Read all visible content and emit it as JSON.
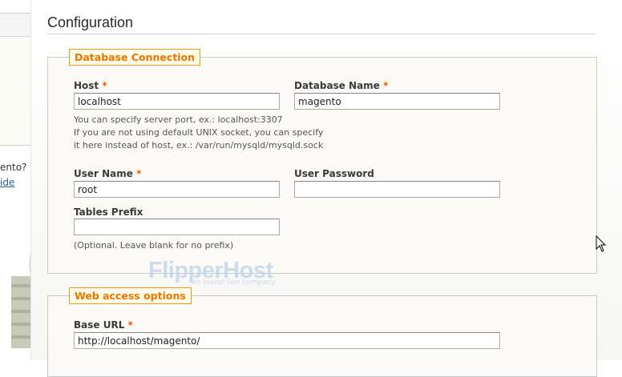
{
  "sidebar": {
    "text": "ento?",
    "link": "ide"
  },
  "page": {
    "title": "Configuration"
  },
  "db_connection": {
    "legend": "Database Connection",
    "host": {
      "label": "Host",
      "required": "*",
      "value": "localhost"
    },
    "db_name": {
      "label": "Database Name",
      "required": "*",
      "value": "magento"
    },
    "host_notes": [
      "You can specify server port, ex.: localhost:3307",
      "If you are not using default UNIX socket, you can specify",
      "it here instead of host, ex.: /var/run/mysqld/mysqld.sock"
    ],
    "user_name": {
      "label": "User Name",
      "required": "*",
      "value": "root"
    },
    "user_password": {
      "label": "User Password",
      "value": ""
    },
    "tables_prefix": {
      "label": "Tables Prefix",
      "value": ""
    },
    "prefix_note": "(Optional. Leave blank for no prefix)"
  },
  "web_access": {
    "legend": "Web access options",
    "base_url": {
      "label": "Base URL",
      "required": "*",
      "value": "http://localhost/magento/"
    }
  },
  "watermark": {
    "brand": "FlipperHost",
    "tagline": "an invest lion company"
  },
  "colors": {
    "accent": "#ea7601",
    "required": "#eb5e00",
    "link": "#1b5fa6"
  },
  "icons": {
    "cursor": "mouse-pointer-icon",
    "mascot": "penguin-mascot-icon"
  }
}
